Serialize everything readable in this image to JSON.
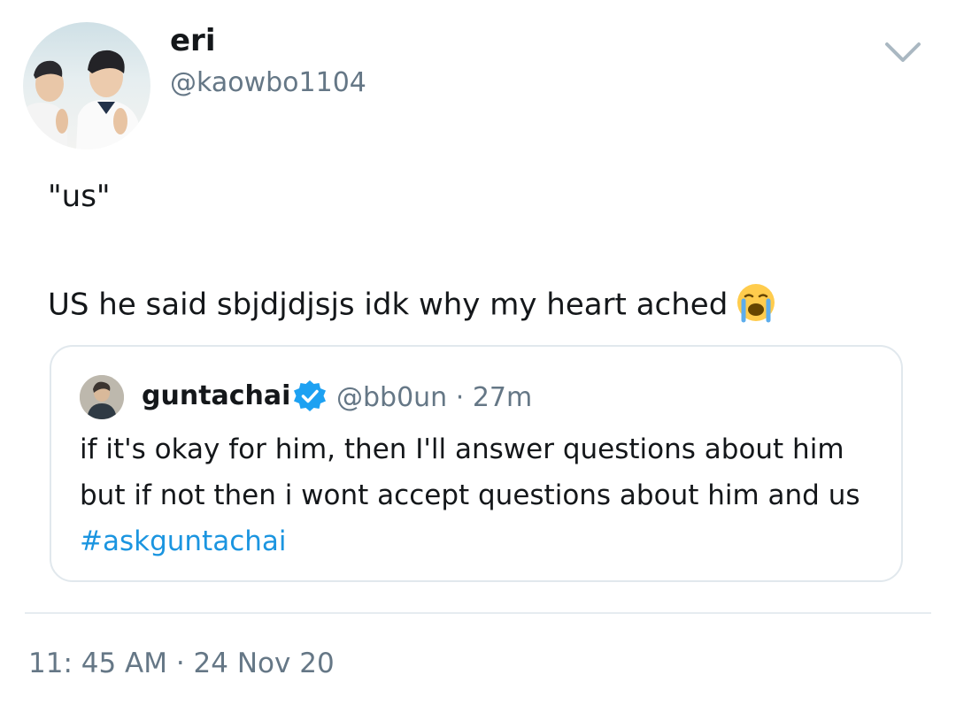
{
  "author": {
    "display_name": "eri",
    "handle": "@kaowbo1104"
  },
  "tweet": {
    "line1": "\"us\"",
    "line2": "US he said sbjdjdjsjs idk why my heart ached",
    "emoji": "loudly-crying-face-icon"
  },
  "quoted_tweet": {
    "display_name": "guntachai",
    "verified": true,
    "handle": "@bb0un",
    "separator": "·",
    "time": "27m",
    "line1": "if it's okay for him,  then I'll answer questions about him",
    "line2": "but if not then i wont accept questions about him and us",
    "hashtag": "#askguntachai"
  },
  "timestamp": "11: 45 AM · 24 Nov 20",
  "colors": {
    "text": "#14171a",
    "secondary": "#657786",
    "link": "#1b95e0",
    "verified": "#1da1f2",
    "border": "#e1e8ed"
  },
  "icons": {
    "caret": "chevron-down-icon",
    "verified": "verified-badge-icon"
  }
}
